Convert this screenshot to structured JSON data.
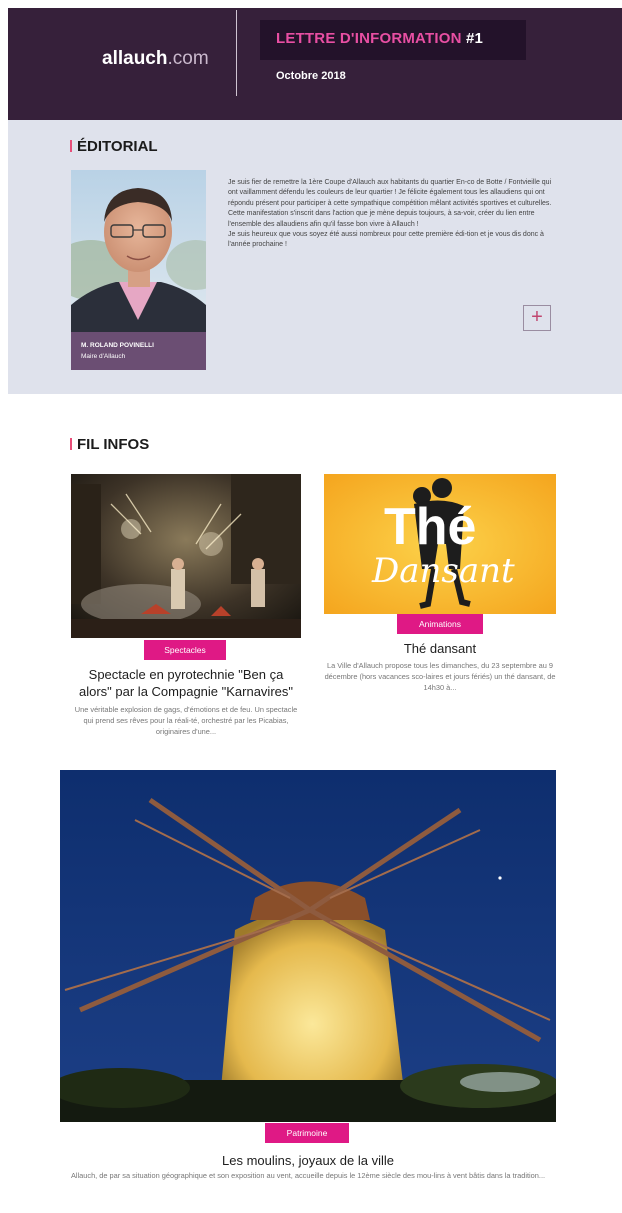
{
  "header": {
    "logo_main": "allauch",
    "logo_suffix": ".com",
    "newsletter_label": "LETTRE D'INFORMATION",
    "newsletter_number": "#1",
    "date": "Octobre 2018"
  },
  "editorial": {
    "title": "ÉDITORIAL",
    "portrait_name": "M. ROLAND POVINELLI",
    "portrait_role": "Maire d'Allauch",
    "paragraphs": [
      "Je suis fier de remettre la 1ère Coupe d'Allauch aux habitants du quartier En-co de Botte / Fontvieille qui ont vaillamment défendu les couleurs de leur quartier ! Je félicite également tous les allaudiens qui ont répondu présent pour participer à cette sympathique compétition mêlant activités sportives et culturelles.",
      "Cette manifestation s'inscrit dans l'action que je mène depuis toujours, à sa-voir, créer du lien entre l'ensemble des allaudiens afin qu'il fasse bon vivre à Allauch !",
      "Je suis heureux que vous soyez été aussi nombreux pour cette première édi-tion et je vous dis donc à l'année prochaine !"
    ],
    "more_label": "+"
  },
  "fil_infos": {
    "title": "FIL INFOS",
    "articles": [
      {
        "category": "Spectacles",
        "title": "Spectacle en pyrotechnie \"Ben ça alors\" par la Compagnie \"Karnavires\"",
        "excerpt": "Une véritable explosion de gags, d'émotions et de feu. Un spectacle qui prend ses rêves pour la réali-té, orchestré par les Picabias, originaires d'une..."
      },
      {
        "category": "Animations",
        "image_text_1": "Thé",
        "image_text_2": "Dansant",
        "title": "Thé dansant",
        "excerpt": "La Ville d'Allauch propose tous les dimanches, du 23 septembre au 9 décembre (hors vacances sco-laires et jours fériés) un thé dansant, de 14h30 à..."
      },
      {
        "category": "Patrimoine",
        "title": "Les moulins, joyaux de la ville",
        "excerpt": "Allauch, de par sa situation géographique et son exposition au vent, accueille depuis le 12ème siècle des mou-lins à vent bâtis dans la tradition..."
      }
    ]
  },
  "colors": {
    "header_bg": "#36203a",
    "accent_pink": "#df1985",
    "editorial_bg": "#dfe2ec"
  }
}
